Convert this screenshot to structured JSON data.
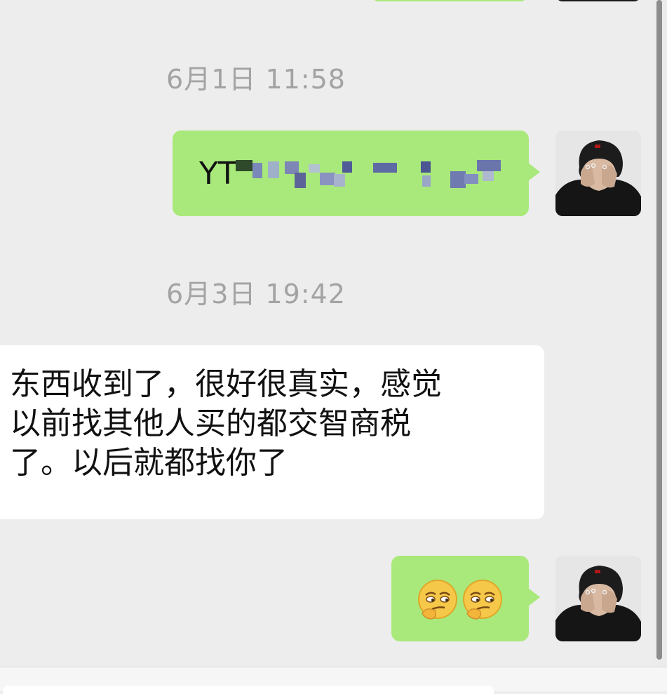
{
  "messages": [
    {
      "type": "timestamp",
      "text": "6月1日 11:58"
    },
    {
      "type": "sent",
      "text": "YT",
      "avatar": "user-avatar"
    },
    {
      "type": "timestamp",
      "text": "6月3日 19:42"
    },
    {
      "type": "received",
      "lines": [
        "东西收到了，很好很真实，感觉",
        "以前找其他人买的都交智商税",
        "了。以后就都找你了"
      ]
    },
    {
      "type": "sent",
      "emojis": [
        "smirk-emoji",
        "smirk-emoji"
      ],
      "avatar": "user-avatar"
    }
  ],
  "colors": {
    "background": "#ededed",
    "sent_bubble": "#a9e97b",
    "received_bubble": "#ffffff",
    "timestamp": "#a3a3a3"
  }
}
